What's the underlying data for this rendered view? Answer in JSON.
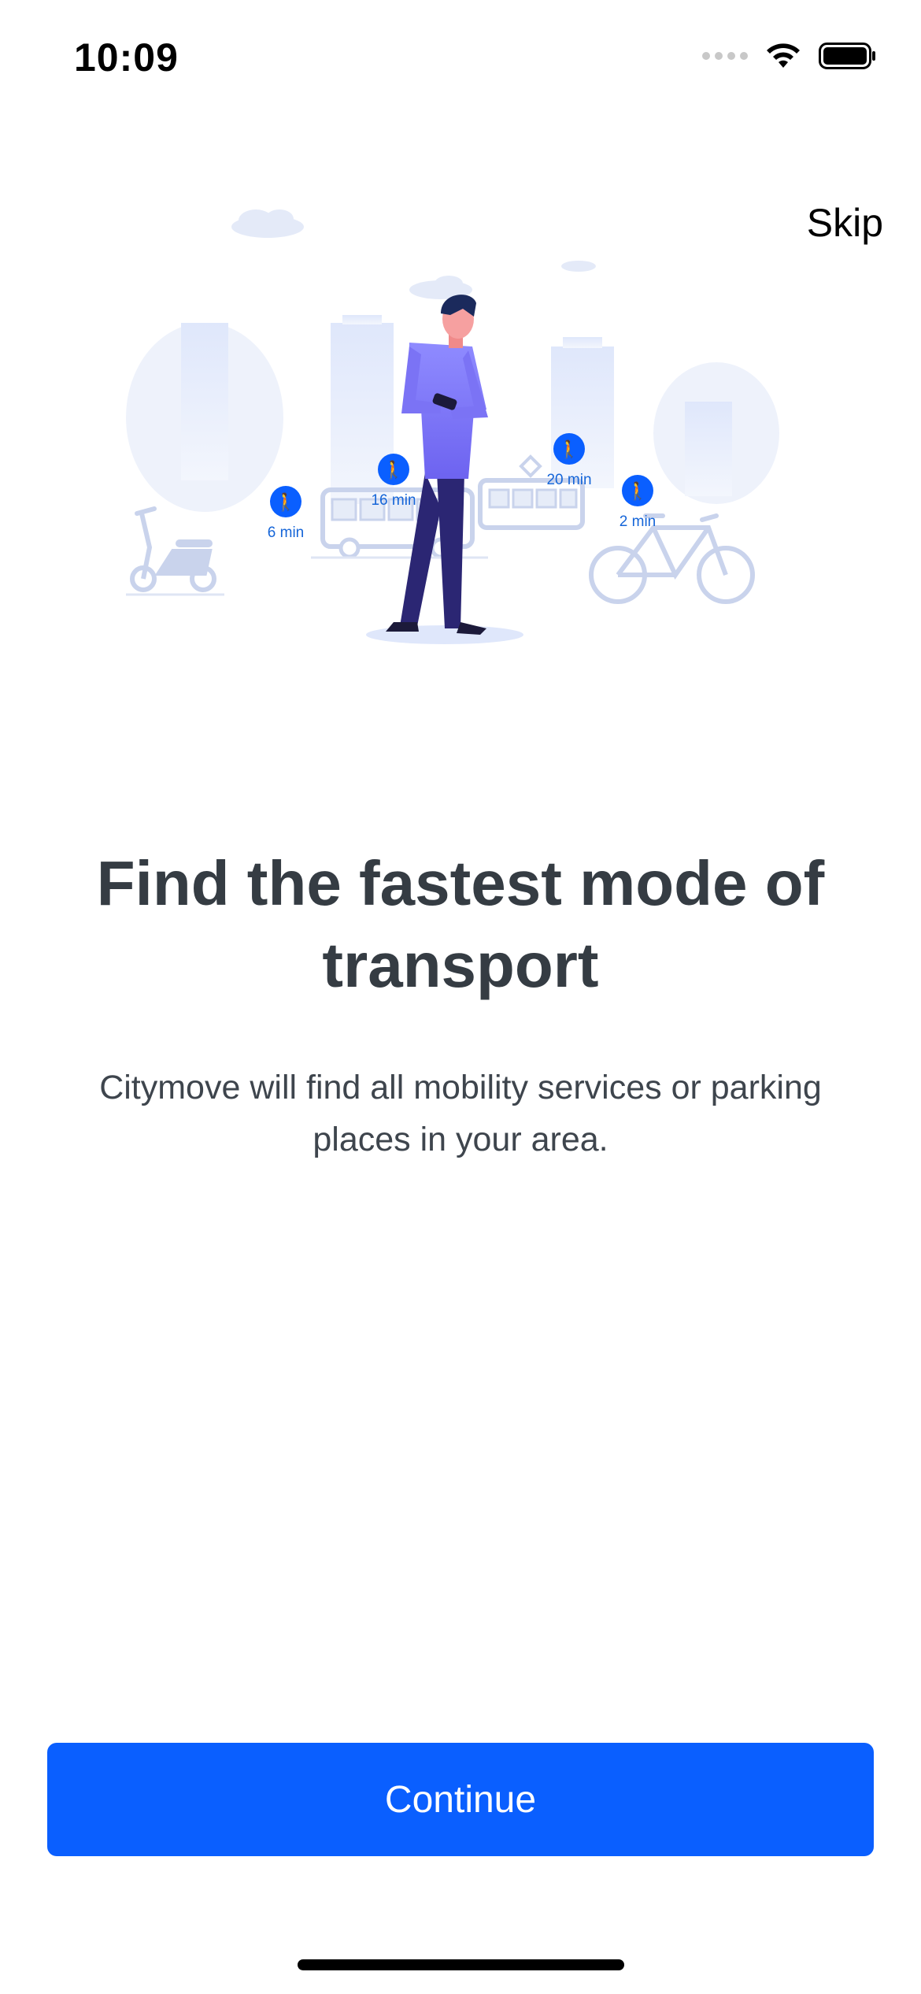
{
  "status_bar": {
    "time": "10:09"
  },
  "header": {
    "skip_label": "Skip"
  },
  "illustration": {
    "walk_times": {
      "scooter": "6 min",
      "bus": "16 min",
      "tram": "20 min",
      "bike": "2 min"
    },
    "icon": "walking-person-icon"
  },
  "onboarding": {
    "title_line1": "Find the fastest mode of",
    "title_line2": "transport",
    "subtitle_line1": "Citymove will find all mobility services or parking",
    "subtitle_line2": "places in your area."
  },
  "actions": {
    "continue_label": "Continue"
  },
  "colors": {
    "accent": "#0a5fff",
    "title": "#353c43",
    "body_text": "#3e454d"
  }
}
